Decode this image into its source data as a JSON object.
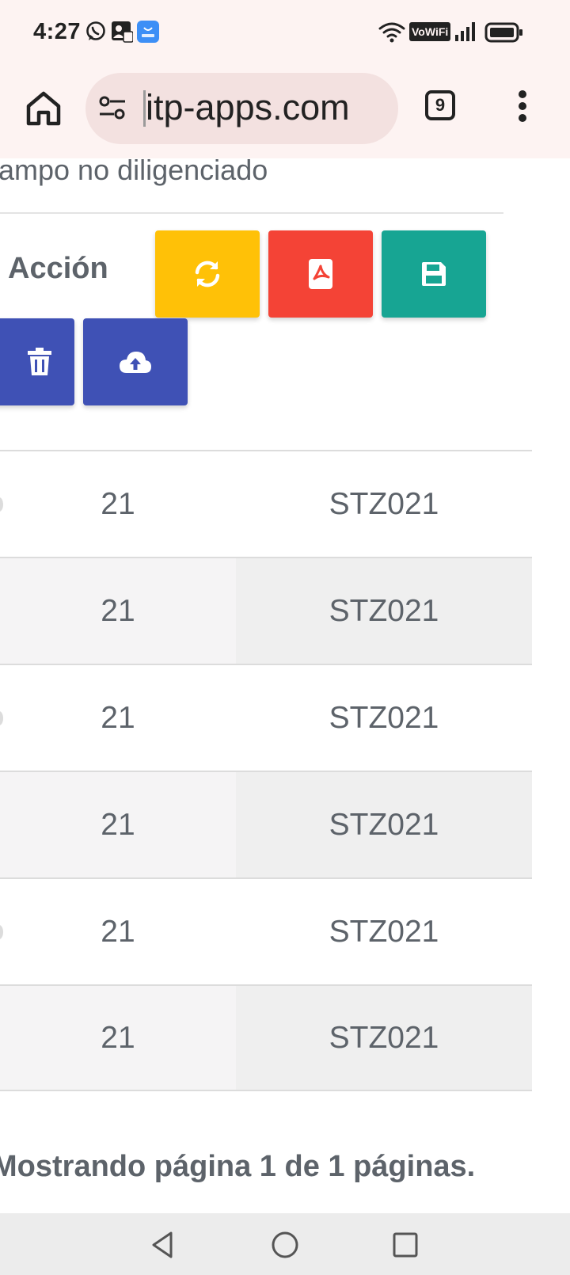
{
  "status_bar": {
    "time": "4:27",
    "icons_left": [
      "whatsapp-icon",
      "contact-card-icon",
      "app-store-icon"
    ],
    "icons_right": [
      "wifi-icon",
      "vowifi-badge",
      "signal-icon",
      "battery-icon"
    ],
    "vowifi_label": "VoWiFi"
  },
  "browser": {
    "url": "itp-apps.com",
    "tab_count": "9"
  },
  "page": {
    "partial_heading": "ampo no diligenciado",
    "accion_label": "Acción",
    "buttons": [
      {
        "name": "refresh-button",
        "icon": "refresh-icon",
        "color": "#ffc107"
      },
      {
        "name": "pdf-button",
        "icon": "pdf-icon",
        "color": "#f44336"
      },
      {
        "name": "save-button",
        "icon": "save-icon",
        "color": "#17a593"
      },
      {
        "name": "delete-button",
        "icon": "trash-icon",
        "color": "#3f51b5"
      },
      {
        "name": "upload-button",
        "icon": "cloud-upload-icon",
        "color": "#3f51b5"
      }
    ],
    "table": {
      "rows": [
        {
          "col1": "21",
          "col2": "STZ021"
        },
        {
          "col1": "21",
          "col2": "STZ021"
        },
        {
          "col1": "21",
          "col2": "STZ021"
        },
        {
          "col1": "21",
          "col2": "STZ021"
        },
        {
          "col1": "21",
          "col2": "STZ021"
        },
        {
          "col1": "21",
          "col2": "STZ021"
        }
      ]
    },
    "pagination_text": "Mostrando página 1 de 1 páginas."
  },
  "nav_bar": {
    "buttons": [
      "back-icon",
      "home-circle-icon",
      "recents-icon"
    ]
  }
}
